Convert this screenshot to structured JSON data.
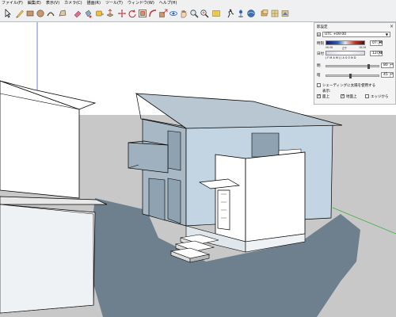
{
  "menu": [
    "ファイル(F)",
    "編集(E)",
    "表示(V)",
    "カメラ(C)",
    "描画(R)",
    "ツール(T)",
    "ウィンドウ(W)",
    "ヘルプ(H)"
  ],
  "toolbar_icons": [
    "select-arrow-icon",
    "pencil-line-icon",
    "rectangle-icon",
    "circle-icon",
    "arc-icon",
    "polygon-icon",
    "eraser-icon",
    "paint-bucket-icon",
    "tape-measure-icon",
    "push-pull-icon",
    "move-icon",
    "rotate-icon",
    "offset-icon",
    "follow-me-icon",
    "scale-icon",
    "orbit-icon",
    "pan-hand-icon",
    "zoom-icon",
    "zoom-extents-icon",
    "section-plane-icon",
    "walk-icon",
    "position-camera-icon",
    "warehouse-icon",
    "components-icon",
    "materials-icon",
    "styles-icon"
  ],
  "shadow_panel": {
    "title": "影設定",
    "close": "×",
    "tz_toggle": "▫",
    "timezone": "UTC +09:00",
    "time_label": "時刻",
    "time_start": "06:56",
    "time_mid": "正午",
    "time_end": "18:26",
    "time_value": "07:30",
    "date_label": "日付",
    "months": "J F M A M J J A S O N D",
    "date_value": "12/22",
    "light_label": "明",
    "light_value": "80",
    "dark_label": "暗",
    "dark_value": "45",
    "light_level": 0.8,
    "dark_level": 0.45,
    "shading_label": "シェーディングに太陽を使用する",
    "shading_checked": false,
    "display_label": "表示:",
    "on_faces_label": "面上",
    "on_faces_checked": true,
    "on_ground_label": "地面上",
    "on_ground_checked": true,
    "from_edges_label": "エッジから",
    "from_edges_checked": false
  },
  "colors": {
    "sky": "#ffffff",
    "ground": "#c8c8c8",
    "shadow": "#6e7f8e",
    "wall_shade": "#a9b8c5",
    "wall_light": "#ffffff",
    "roof": "#b9c7d2",
    "wall_blue": "#c3d4e2"
  }
}
